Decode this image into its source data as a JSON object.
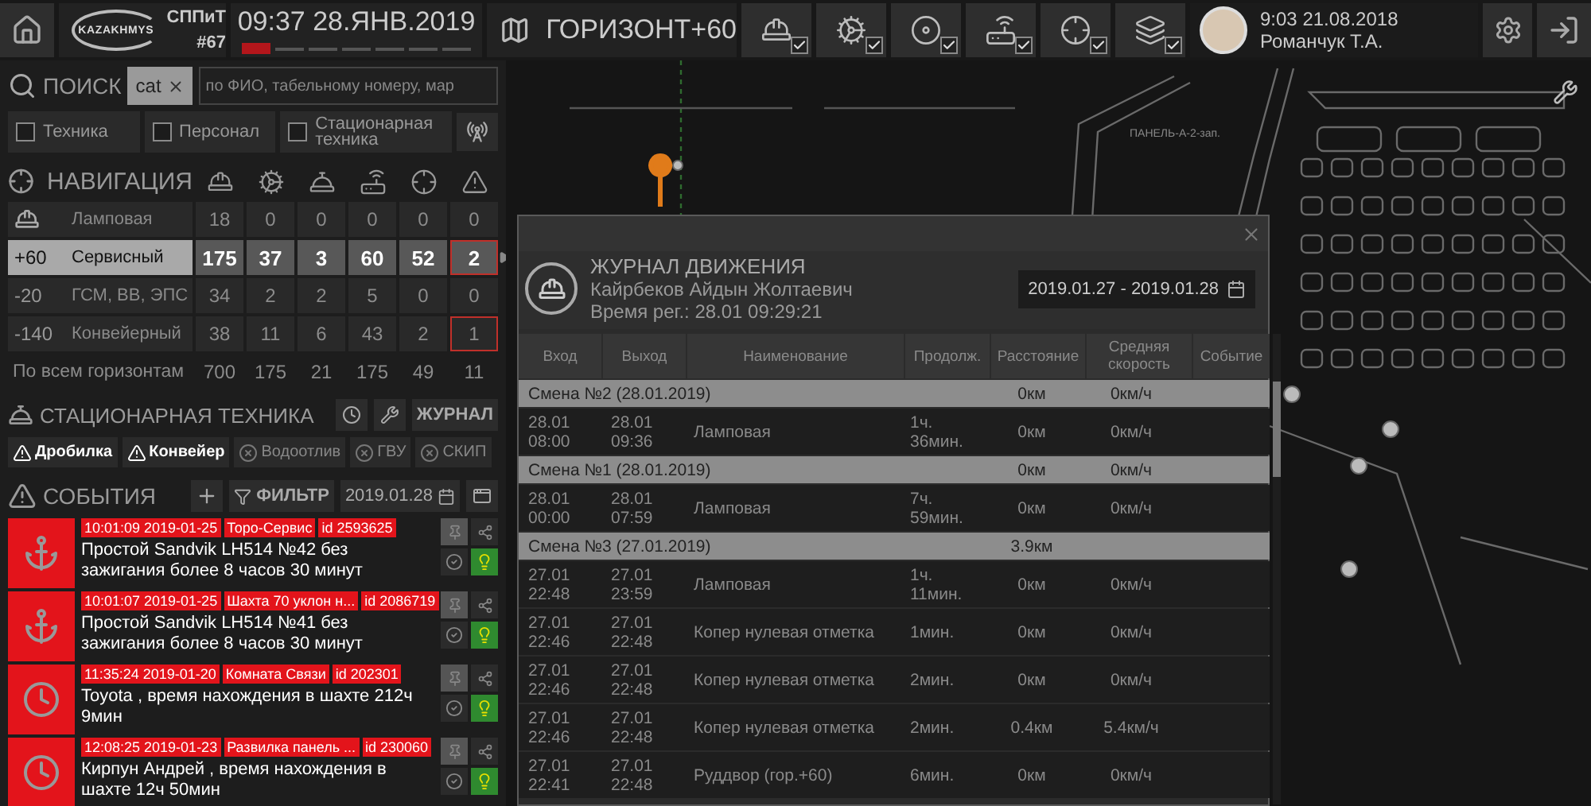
{
  "top_bar": {
    "logo": {
      "brand": "KAZAKHMYS",
      "unit": "СППиТ",
      "number": "#67"
    },
    "clock": {
      "time": "09:37 28.ЯНВ.2019",
      "segments": [
        {
          "active": true
        },
        {
          "active": false
        },
        {
          "active": false
        },
        {
          "active": false
        },
        {
          "active": false
        },
        {
          "active": false
        },
        {
          "active": false
        }
      ]
    },
    "horizon": "ГОРИЗОНТ+60",
    "layer_toggles": [
      {
        "kind": "personnel",
        "checked": true
      },
      {
        "kind": "equipment",
        "checked": true
      },
      {
        "kind": "equipment-alt",
        "checked": true
      },
      {
        "kind": "network",
        "checked": true
      },
      {
        "kind": "positioning",
        "checked": true
      },
      {
        "kind": "layers",
        "checked": true
      }
    ],
    "user": {
      "time": "9:03 21.08.2018",
      "name": "Романчук Т.А."
    }
  },
  "search": {
    "label": "ПОИСК",
    "chip": "cat",
    "placeholder": "по ФИО, табельному номеру, мар"
  },
  "filters": [
    {
      "label": "Техника",
      "checked": false
    },
    {
      "label": "Персонал",
      "checked": false
    },
    {
      "label": "Стационарная техника",
      "checked": false
    }
  ],
  "navigation": {
    "title": "НАВИГАЦИЯ",
    "columns": [
      {
        "kind": "personnel"
      },
      {
        "kind": "equipment"
      },
      {
        "kind": "stationary"
      },
      {
        "kind": "network"
      },
      {
        "kind": "positioning"
      },
      {
        "kind": "alarms"
      }
    ],
    "rows": [
      {
        "kind": "lamp-room",
        "level": "",
        "name": "Ламповая",
        "values": [
          "18",
          "0",
          "0",
          "0",
          "0",
          "0"
        ],
        "selected": false,
        "alert": false
      },
      {
        "kind": "horizon",
        "level": "+60",
        "name": "Сервисный",
        "values": [
          "175",
          "37",
          "3",
          "60",
          "52",
          "2"
        ],
        "selected": true,
        "alert": true
      },
      {
        "kind": "horizon",
        "level": "-20",
        "name": "ГСМ, ВВ, ЭПС",
        "values": [
          "34",
          "2",
          "2",
          "5",
          "0",
          "0"
        ],
        "selected": false,
        "alert": false
      },
      {
        "kind": "horizon",
        "level": "-140",
        "name": "Конвейерный",
        "values": [
          "38",
          "11",
          "6",
          "43",
          "2",
          "1"
        ],
        "selected": false,
        "alert": true
      }
    ],
    "total": {
      "label": "По всем горизонтам",
      "values": [
        "700",
        "175",
        "21",
        "175",
        "49",
        "11"
      ]
    }
  },
  "stationary": {
    "title": "СТАЦИОНАРНАЯ ТЕХНИКА",
    "journal_button": "ЖУРНАЛ",
    "items": [
      {
        "label": "Дробилка",
        "alarm": true
      },
      {
        "label": "Конвейер",
        "alarm": true
      },
      {
        "label": "Водоотлив",
        "alarm": false
      },
      {
        "label": "ГВУ",
        "alarm": false
      },
      {
        "label": "СКИП",
        "alarm": false
      }
    ]
  },
  "events": {
    "title": "СОБЫТИЯ",
    "filter_button": "ФИЛЬТР",
    "date": "2019.01.28",
    "items": [
      {
        "kind": "anchor",
        "time": "10:01:09 2019-01-25",
        "place": "Торо-Сервис",
        "id": "id 2593625",
        "text": "Простой Sandvik LH514 №42 без зажигания более 8 часов 30 минут"
      },
      {
        "kind": "anchor",
        "time": "10:01:07 2019-01-25",
        "place": "Шахта 70 уклон н...",
        "id": "id 2086719",
        "text": "Простой Sandvik LH514 №41 без зажигания более 8 часов 30 минут"
      },
      {
        "kind": "clock",
        "time": "11:35:24 2019-01-20",
        "place": "Комната Связи",
        "id": "id 202301",
        "text": "Toyota , время нахождения в шахте 212ч 9мин"
      },
      {
        "kind": "clock",
        "time": "12:08:25 2019-01-23",
        "place": "Развилка панель ...",
        "id": "id 230060",
        "text": "Кирпун Андрей , время нахождения в шахте 12ч 50мин"
      }
    ]
  },
  "map": {
    "label": "ПАНЕЛЬ-А-2-зап."
  },
  "journal": {
    "title": "ЖУРНАЛ ДВИЖЕНИЯ",
    "person": "Кайрбеков Айдын Жолтаевич",
    "registered": "Время рег.: 28.01 09:29:21",
    "date_range": "2019.01.27 - 2019.01.28",
    "columns": [
      "Вход",
      "Выход",
      "Наименование",
      "Продолж.",
      "Расстояние",
      "Средняя скорость",
      "Событие"
    ],
    "rows": [
      {
        "kind": "shift",
        "label": "Смена №2 (28.01.2019)",
        "distance": "0км",
        "speed": "0км/ч"
      },
      {
        "kind": "entry",
        "in": "28.01 08:00",
        "out": "28.01 09:36",
        "name": "Ламповая",
        "duration": "1ч. 36мин.",
        "distance": "0км",
        "speed": "0км/ч"
      },
      {
        "kind": "shift",
        "label": "Смена №1 (28.01.2019)",
        "distance": "0км",
        "speed": "0км/ч"
      },
      {
        "kind": "entry",
        "in": "28.01 00:00",
        "out": "28.01 07:59",
        "name": "Ламповая",
        "duration": "7ч. 59мин.",
        "distance": "0км",
        "speed": "0км/ч"
      },
      {
        "kind": "shift",
        "label": "Смена №3 (27.01.2019)",
        "distance": "3.9км"
      },
      {
        "kind": "entry",
        "in": "27.01 22:48",
        "out": "27.01 23:59",
        "name": "Ламповая",
        "duration": "1ч. 11мин.",
        "distance": "0км",
        "speed": "0км/ч"
      },
      {
        "kind": "entry",
        "in": "27.01 22:46",
        "out": "27.01 22:48",
        "name": "Копер нулевая отметка",
        "duration": "1мин.",
        "distance": "0км",
        "speed": "0км/ч"
      },
      {
        "kind": "entry",
        "in": "27.01 22:46",
        "out": "27.01 22:48",
        "name": "Копер нулевая отметка",
        "duration": "2мин.",
        "distance": "0км",
        "speed": "0км/ч"
      },
      {
        "kind": "entry",
        "in": "27.01 22:46",
        "out": "27.01 22:48",
        "name": "Копер нулевая отметка",
        "duration": "2мин.",
        "distance": "0.4км",
        "speed": "5.4км/ч"
      },
      {
        "kind": "entry",
        "in": "27.01 22:41",
        "out": "27.01 22:48",
        "name": "Руддвор (гор.+60)",
        "duration": "6мин.",
        "distance": "0км",
        "speed": "0км/ч"
      }
    ]
  }
}
